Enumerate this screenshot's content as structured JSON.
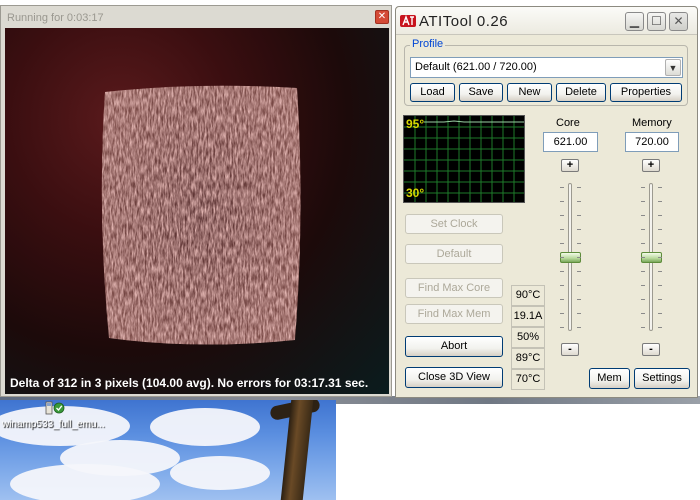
{
  "render_window": {
    "title": "Running for 0:03:17",
    "status": "Delta of 312 in 3 pixels (104.00 avg). No errors for 03:17.31 sec."
  },
  "ati_tool": {
    "title": "ATITool 0.26",
    "profile": {
      "label": "Profile",
      "selected": "Default (621.00 / 720.00)",
      "buttons": {
        "load": "Load",
        "save": "Save",
        "new": "New",
        "delete": "Delete",
        "properties": "Properties"
      }
    },
    "graph": {
      "max_label": "95°",
      "min_label": "30°"
    },
    "core": {
      "label": "Core",
      "value": "621.00",
      "slider_level": 0.5
    },
    "memory": {
      "label": "Memory",
      "value": "720.00",
      "slider_level": 0.5
    },
    "buttons": {
      "set_clock": "Set Clock",
      "default": "Default",
      "find_max_core": "Find Max Core",
      "find_max_mem": "Find Max Mem",
      "abort": "Abort",
      "close_3d_view": "Close 3D View",
      "mem": "Mem",
      "settings": "Settings"
    },
    "readouts": [
      "90°C",
      "19.1A",
      "50%",
      "89°C",
      "70°C"
    ]
  },
  "desktop": {
    "icon_label": "winamp533_full_emu..."
  }
}
